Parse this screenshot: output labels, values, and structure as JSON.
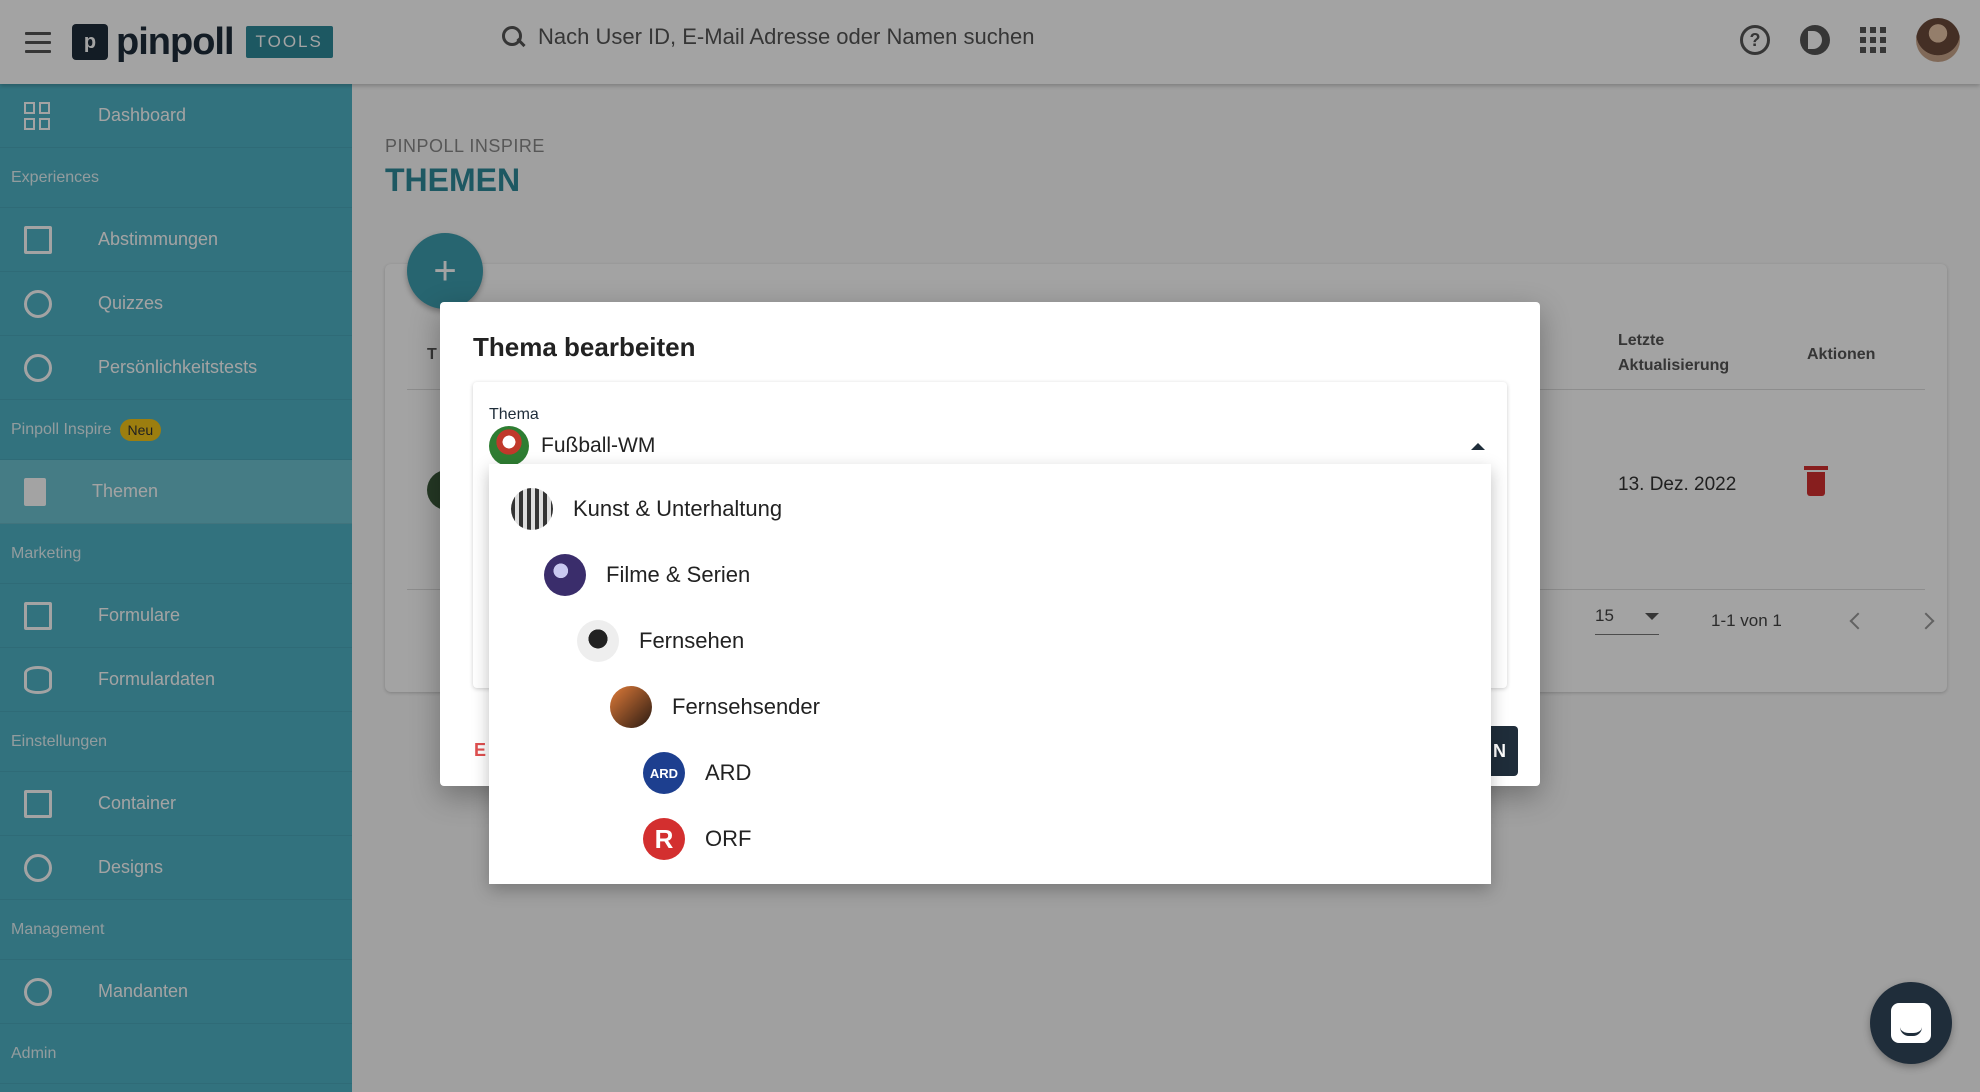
{
  "header": {
    "logo_mark": "p",
    "logo_text": "pinpoll",
    "logo_tag": "TOOLS",
    "search_placeholder": "Nach User ID, E-Mail Adresse oder Namen suchen"
  },
  "sidebar": {
    "items": [
      {
        "label": "Dashboard",
        "icon": "dashboard-icon"
      },
      {
        "section": "Experiences"
      },
      {
        "label": "Abstimmungen",
        "icon": "chart-icon"
      },
      {
        "label": "Quizzes",
        "icon": "quiz-icon"
      },
      {
        "label": "Persönlichkeitstests",
        "icon": "mask-icon"
      },
      {
        "section": "Pinpoll Inspire",
        "badge": "Neu"
      },
      {
        "label": "Themen",
        "icon": "book-icon",
        "active": true
      },
      {
        "section": "Marketing"
      },
      {
        "label": "Formulare",
        "icon": "form-icon"
      },
      {
        "label": "Formulardaten",
        "icon": "database-icon"
      },
      {
        "section": "Einstellungen"
      },
      {
        "label": "Container",
        "icon": "container-icon"
      },
      {
        "label": "Designs",
        "icon": "palette-icon"
      },
      {
        "section": "Management"
      },
      {
        "label": "Mandanten",
        "icon": "people-icon"
      },
      {
        "section": "Admin"
      }
    ]
  },
  "page": {
    "breadcrumb": "PINPOLL INSPIRE",
    "title": "THEMEN",
    "fab_label": "+"
  },
  "table": {
    "col_first_partial": "T",
    "col_updated_line1": "Letzte",
    "col_updated_line2": "Aktualisierung",
    "col_actions": "Aktionen",
    "row_date": "13. Dez. 2022",
    "page_size": "15",
    "page_range": "1-1 von 1"
  },
  "dialog": {
    "title": "Thema bearbeiten",
    "field_label": "Thema",
    "field_value": "Fußball-WM",
    "left_button_partial": "E",
    "right_button_partial": "N"
  },
  "dropdown": {
    "options": [
      {
        "label": "Kunst & Unterhaltung",
        "level": 0
      },
      {
        "label": "Filme & Serien",
        "level": 1
      },
      {
        "label": "Fernsehen",
        "level": 2
      },
      {
        "label": "Fernsehsender",
        "level": 3
      },
      {
        "label": "ARD",
        "level": 4,
        "thumb_text": "ARD"
      },
      {
        "label": "ORF",
        "level": 4,
        "thumb_text": "R"
      }
    ]
  },
  "colors": {
    "sidebar": "#4fb3c6",
    "accent": "#2e8a9a",
    "dark": "#1f2d3a",
    "danger": "#d32f2f",
    "badge": "#f5c518"
  }
}
